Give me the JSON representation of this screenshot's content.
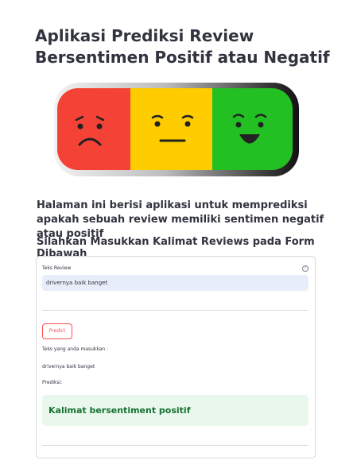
{
  "title_line1": "Aplikasi Prediksi Review",
  "title_line2": "Bersentimen Positif atau Negatif",
  "mood_banner": {
    "faces": [
      "sad-face",
      "neutral-face",
      "happy-face"
    ],
    "colors": {
      "sad": "#f44336",
      "neutral": "#ffcc00",
      "happy": "#22c022"
    }
  },
  "intro_text": "Halaman ini berisi aplikasi untuk memprediksi apakah sebuah review memiliki sentimen negatif atau positif",
  "form_heading": "Silahkan Masukkan Kalimat Reviews pada Form Dibawah",
  "form": {
    "field_label": "Teks Review",
    "help_icon": "?",
    "input_value": "drivernya baik banget",
    "predict_label": "Predict",
    "echo_label": "Teks yang anda masukkan :",
    "echo_value": "drivernya baik banget",
    "prediction_label": "Prediksi:",
    "result_text": "Kalimat bersentiment positif"
  },
  "colors": {
    "accent": "#ff4b4b",
    "success_bg": "#e9f7ec",
    "success_text": "#177233"
  }
}
